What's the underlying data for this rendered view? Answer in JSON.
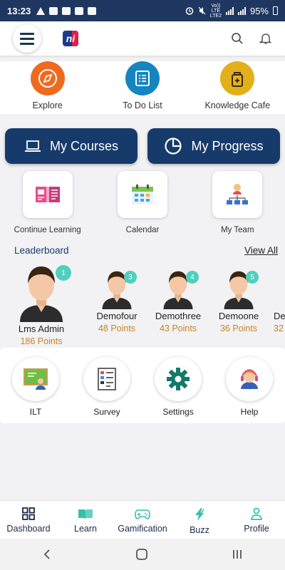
{
  "status_bar": {
    "time": "13:23",
    "network_top": "Vo))",
    "network_lte": "LTE",
    "network_lte2": "LTE2",
    "network_lte_mid": "LTE",
    "battery": "95%"
  },
  "app_bar": {
    "logo_text": "ni",
    "menu_icon": "hamburger-icon",
    "search_icon": "search-icon",
    "bell_icon": "bell-icon"
  },
  "quick_links": [
    {
      "label": "Explore",
      "icon": "compass-icon",
      "color": "#ee6a1f"
    },
    {
      "label": "To Do List",
      "icon": "list-icon",
      "color": "#1585c2"
    },
    {
      "label": "Knowledge Cafe",
      "icon": "cafe-icon",
      "color": "#e2b019"
    }
  ],
  "primary_buttons": {
    "my_courses": "My Courses",
    "my_progress": "My Progress",
    "color": "#163a6a"
  },
  "tiles": [
    {
      "label": "Continue Learning",
      "icon": "book-icon"
    },
    {
      "label": "Calendar",
      "icon": "calendar-icon"
    },
    {
      "label": "My Team",
      "icon": "team-icon"
    }
  ],
  "leaderboard": {
    "title": "Leaderboard",
    "view_all": "View All",
    "players": [
      {
        "rank": "1",
        "name": "Lms Admin",
        "points": "186 Points"
      },
      {
        "rank": "3",
        "name": "Demofour",
        "points": "48 Points"
      },
      {
        "rank": "4",
        "name": "Demothree",
        "points": "43 Points"
      },
      {
        "rank": "5",
        "name": "Demoone",
        "points": "36 Points"
      },
      {
        "rank": "",
        "name": "De",
        "points": "32"
      }
    ]
  },
  "features": [
    {
      "label": "ILT",
      "icon": "classroom-icon"
    },
    {
      "label": "Survey",
      "icon": "survey-icon"
    },
    {
      "label": "Settings",
      "icon": "gear-icon"
    },
    {
      "label": "Help",
      "icon": "headset-icon"
    }
  ],
  "bottom_nav": {
    "items": [
      {
        "label": "Dashboard",
        "icon": "dashboard-icon",
        "color": "#1b2a4a"
      },
      {
        "label": "Learn",
        "icon": "learn-icon",
        "color": "#1b2a4a"
      },
      {
        "label": "Gamification",
        "icon": "gamepad-icon",
        "color": "#1b2a4a"
      },
      {
        "label": "Buzz",
        "icon": "lightning-icon",
        "color": "#1b2a4a"
      },
      {
        "label": "Profile",
        "icon": "profile-icon",
        "color": "#1b2a4a"
      }
    ],
    "icon_color": "#36c0a9"
  },
  "system_nav": {
    "back_icon": "back-icon",
    "home_icon": "home-icon",
    "recents_icon": "recents-icon"
  }
}
